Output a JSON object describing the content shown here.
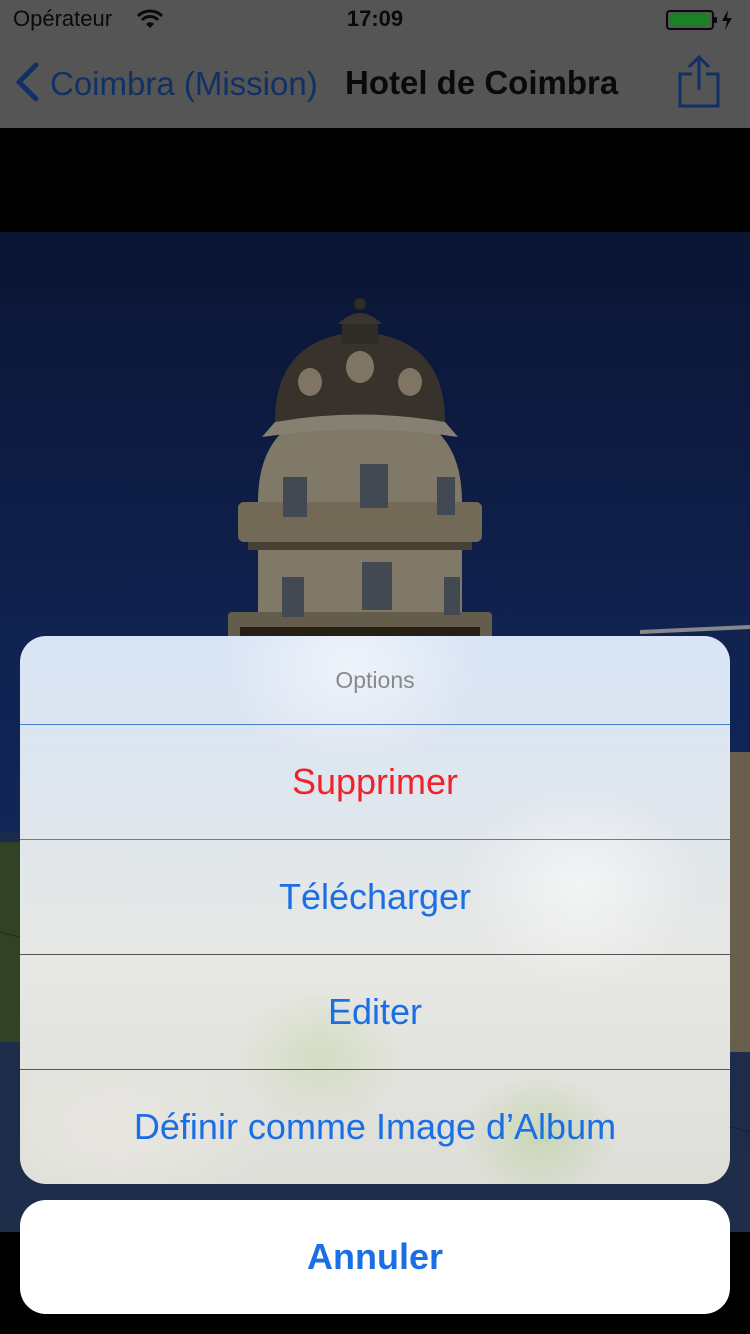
{
  "status_bar": {
    "carrier": "Opérateur",
    "time": "17:09",
    "wifi_icon": "wifi-icon",
    "battery_icon": "battery-charging-icon"
  },
  "nav": {
    "back_label": "Coimbra (Mission)",
    "title": "Hotel de Coimbra",
    "share_icon": "share-icon"
  },
  "action_sheet": {
    "title": "Options",
    "items": [
      {
        "label": "Supprimer",
        "style": "destructive"
      },
      {
        "label": "Télécharger",
        "style": "default"
      },
      {
        "label": "Editer",
        "style": "default"
      },
      {
        "label": "Définir comme Image d’Album",
        "style": "default"
      }
    ],
    "cancel_label": "Annuler"
  },
  "colors": {
    "accent": "#1a6ee6",
    "destructive": "#f0222c",
    "nav_back": "#1a4fa3"
  }
}
